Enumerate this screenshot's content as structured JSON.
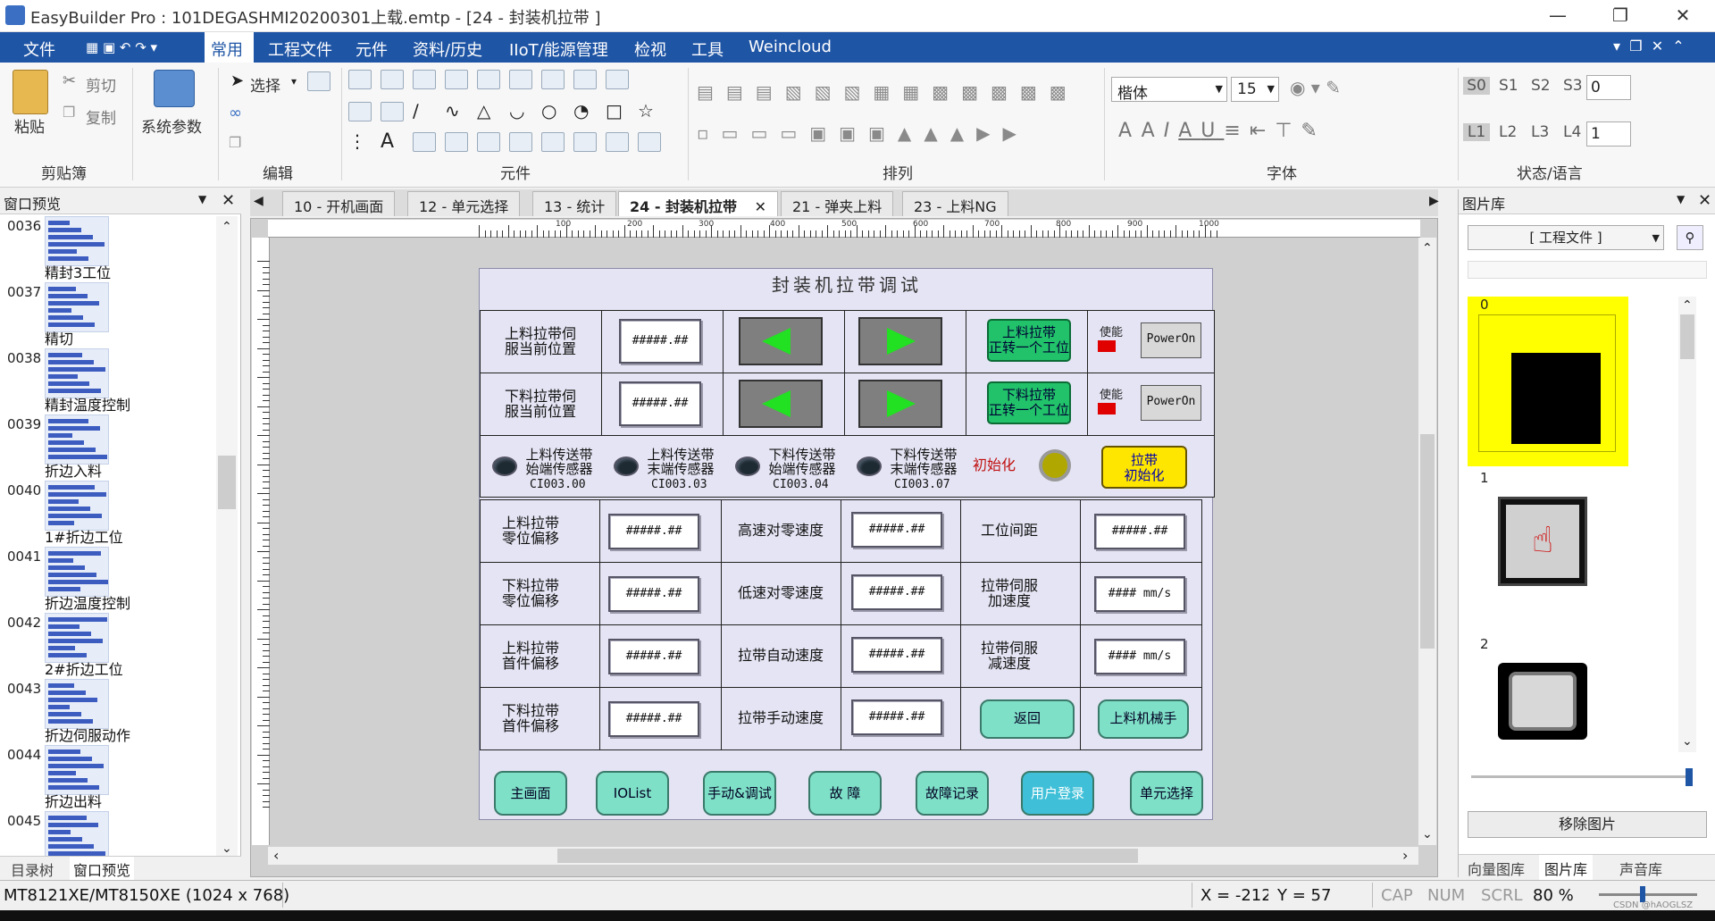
{
  "window": {
    "title": "EasyBuilder Pro : 101DEGASHMI20200301上载.emtp - [24 - 封装机拉带 ]"
  },
  "menu": {
    "items": [
      "文件",
      "常用",
      "工程文件",
      "元件",
      "资料/历史",
      "IIoT/能源管理",
      "检视",
      "工具",
      "Weincloud"
    ],
    "active": "常用"
  },
  "ribbon": {
    "clipboard": {
      "paste": "粘贴",
      "cut": "剪切",
      "copy": "复制",
      "label": "剪贴簿"
    },
    "system": {
      "params": "系统参数"
    },
    "edit": {
      "select": "选择",
      "label": "编辑"
    },
    "elements": {
      "label": "元件"
    },
    "arrange": {
      "label": "排列"
    },
    "font": {
      "name": "楷体",
      "size": "15",
      "label": "字体"
    },
    "state": {
      "s_buttons": [
        "S0",
        "S1",
        "S2",
        "S3"
      ],
      "s_value": "0",
      "l_buttons": [
        "L1",
        "L2",
        "L3",
        "L4"
      ],
      "l_value": "1",
      "label": "状态/语言"
    }
  },
  "left_panel": {
    "title": "窗口预览",
    "items": [
      {
        "num": "0036",
        "name": "精封3工位"
      },
      {
        "num": "0037",
        "name": "精切"
      },
      {
        "num": "0038",
        "name": "精封温度控制"
      },
      {
        "num": "0039",
        "name": "折边入料"
      },
      {
        "num": "0040",
        "name": "1#折边工位"
      },
      {
        "num": "0041",
        "name": "折边温度控制"
      },
      {
        "num": "0042",
        "name": "2#折边工位"
      },
      {
        "num": "0043",
        "name": "折边伺服动作"
      },
      {
        "num": "0044",
        "name": "折边出料"
      },
      {
        "num": "0045",
        "name": ""
      }
    ],
    "tabs": [
      "目录树",
      "窗口预览"
    ]
  },
  "doc_tabs": [
    "10 - 开机画面",
    "12 - 单元选择",
    "13 - 统计",
    "24 - 封装机拉带",
    "21 - 弹夹上料",
    "23 - 上料NG"
  ],
  "ruler_labels": [
    "100",
    "200",
    "300",
    "400",
    "500",
    "600",
    "700",
    "800",
    "900",
    "1000"
  ],
  "hmi": {
    "title": "封装机拉带调试",
    "servo_rows": [
      {
        "label1": "上料拉带伺",
        "label2": "服当前位置",
        "value": "#####.##",
        "fwd1": "上料拉带",
        "fwd2": "正转一个工位",
        "enable": "使能",
        "power": "PowerOn"
      },
      {
        "label1": "下料拉带伺",
        "label2": "服当前位置",
        "value": "#####.##",
        "fwd1": "下料拉带",
        "fwd2": "正转一个工位",
        "enable": "使能",
        "power": "PowerOn"
      }
    ],
    "sensors": [
      {
        "l1": "上料传送带",
        "l2": "始端传感器",
        "addr": "CI003.00"
      },
      {
        "l1": "上料传送带",
        "l2": "末端传感器",
        "addr": "CI003.03"
      },
      {
        "l1": "下料传送带",
        "l2": "始端传感器",
        "addr": "CI003.04"
      },
      {
        "l1": "下料传送带",
        "l2": "末端传感器",
        "addr": "CI003.07"
      }
    ],
    "init_label": "初始化",
    "init_btn1": "拉带",
    "init_btn2": "初始化",
    "grid": [
      {
        "a1": "上料拉带",
        "a2": "零位偏移",
        "v1": "#####.##",
        "b1": "高速对零速度",
        "b2": "",
        "v2": "#####.##",
        "c1": "工位间距",
        "c2": "",
        "v3": "#####.##"
      },
      {
        "a1": "下料拉带",
        "a2": "零位偏移",
        "v1": "#####.##",
        "b1": "低速对零速度",
        "b2": "",
        "v2": "#####.##",
        "c1": "拉带伺服",
        "c2": "加速度",
        "v3": "#### mm/s"
      },
      {
        "a1": "上料拉带",
        "a2": "首件偏移",
        "v1": "#####.##",
        "b1": "拉带自动速度",
        "b2": "",
        "v2": "#####.##",
        "c1": "拉带伺服",
        "c2": "减速度",
        "v3": "#### mm/s"
      },
      {
        "a1": "下料拉带",
        "a2": "首件偏移",
        "v1": "#####.##",
        "b1": "拉带手动速度",
        "b2": "",
        "v2": "#####.##",
        "c1": "",
        "c2": "",
        "v3": ""
      }
    ],
    "return_btn": "返回",
    "robot_btn": "上料机械手",
    "bottom_buttons": [
      "主画面",
      "IOList",
      "手动&调试",
      "故 障",
      "故障记录",
      "用户登录",
      "单元选择"
    ]
  },
  "right_panel": {
    "title": "图片库",
    "dropdown": "[ 工程文件 ]",
    "slots": [
      "0",
      "1",
      "2"
    ],
    "remove_btn": "移除图片",
    "tabs": [
      "向量图库",
      "图片库",
      "声音库"
    ]
  },
  "status": {
    "model": "MT8121XE/MT8150XE (1024 x 768)",
    "x": "X = -212",
    "y": "Y = 57",
    "cap": "CAP",
    "num": "NUM",
    "scrl": "SCRL",
    "zoom": "80 %",
    "watermark": "CSDN @hAOGLSZ"
  },
  "colors": {
    "menubar": "#1f55a5",
    "hmi_bg": "#e4e4f4",
    "green_btn": "#21c26a",
    "teal_btn": "#7fe0c8",
    "yellow_btn": "#ffe600",
    "selection": "#ffff00"
  }
}
